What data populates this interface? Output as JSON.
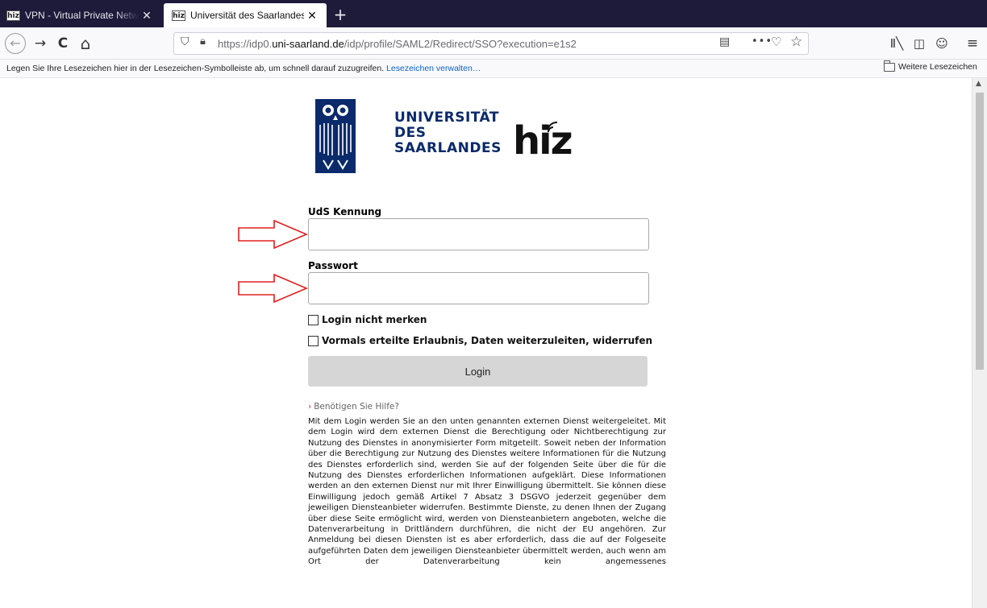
{
  "tabs": [
    {
      "favicon": "hiz",
      "title": "VPN - Virtual Private Network -",
      "close": "✕"
    },
    {
      "favicon": "hiz",
      "title": "Universität des Saarlandes",
      "close": "✕"
    }
  ],
  "newtab": "+",
  "nav": {
    "back": "←",
    "forward": "→",
    "reload": "C",
    "home": "⌂"
  },
  "url": {
    "prefix": "https://idp0.",
    "host": "uni-saarland.de",
    "path": "/idp/profile/SAML2/Redirect/SSO?execution=e1s2",
    "more": "•••"
  },
  "bookmarks": {
    "hint": "Legen Sie Ihre Lesezeichen hier in der Lesezeichen-Symbolleiste ab, um schnell darauf zuzugreifen.",
    "manage_link": "Lesezeichen verwalten…",
    "other": "Weitere Lesezeichen"
  },
  "logo": {
    "line1": "UNIVERSITÄT",
    "line2": "DES",
    "line3": "SAARLANDES",
    "hiz": "hiz"
  },
  "form": {
    "username_label": "UdS Kennung",
    "username_value": "",
    "password_label": "Passwort",
    "password_value": "",
    "remember_label": "Login nicht merken",
    "revoke_label": "Vormals erteilte Erlaubnis, Daten weiterzuleiten, widerrufen",
    "login_button": "Login"
  },
  "help": {
    "chevron": "›",
    "text": "Benötigen Sie Hilfe?"
  },
  "info_text": "Mit dem Login werden Sie an den unten genannten externen Dienst weitergeleitet. Mit dem Login wird dem externen Dienst die Berechtigung oder Nichtberechtigung zur Nutzung des Dienstes in anonymisierter Form mitgeteilt. Soweit neben der Information über die Berechtigung zur Nutzung des Dienstes weitere Informationen für die Nutzung des Dienstes erforderlich sind, werden Sie auf der folgenden Seite über die für die Nutzung des Dienstes erforderlichen Informationen aufgeklärt. Diese Informationen werden an den externen Dienst nur mit Ihrer Einwilligung übermittelt. Sie können diese Einwilligung jedoch gemäß Artikel 7 Absatz 3 DSGVO jederzeit gegenüber dem jeweiligen Diensteanbieter widerrufen. Bestimmte Dienste, zu denen Ihnen der Zugang über diese Seite ermöglicht wird, werden von Diensteanbietern angeboten, welche die Datenverarbeitung in Drittländern durchführen, die nicht der EU angehören. Zur Anmeldung bei diesen Diensten ist es aber erforderlich, dass die auf der Folgeseite aufgeführten Daten dem jeweiligen Diensteanbieter übermittelt werden, auch wenn am Ort der Datenverarbeitung kein angemessenes",
  "colors": {
    "tabbar_bg": "#1e1a3a",
    "logo_blue": "#0a2a6b",
    "annotation_red": "#e02020",
    "login_button_bg": "#d6d6d6"
  }
}
